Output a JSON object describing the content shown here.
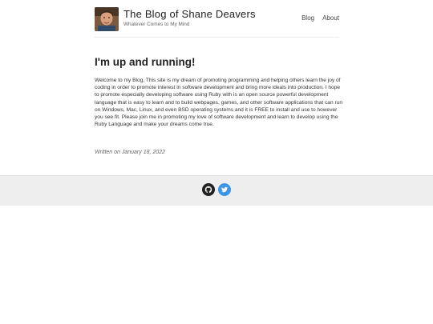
{
  "site": {
    "title": "The Blog of Shane Deavers",
    "tagline": "Whatever Comes to My Mind"
  },
  "nav": {
    "items": [
      {
        "label": "Blog"
      },
      {
        "label": "About"
      }
    ]
  },
  "post": {
    "title": "I'm up and running!",
    "body": "Welcome to my Blog, This site is my dream of promoting programming and helping others learn the joy of coding in order to promote interest in software development and bring more ideals into production. I hope to promote especially developing software using Ruby with is an open source powerful development language that is easy to learn and to build webpages, games, and other software applications that can run on Windows, Mac, Linux, and even BSD operating systems and it is FREE to install and use to however you see fit. Please join me in promoting my love of software development and learn to develop using the Ruby Language and make your dreams come true.",
    "date": "Written on January 18, 2022"
  },
  "footer": {
    "icons": [
      {
        "name": "github-icon",
        "color": "#222222"
      },
      {
        "name": "twitter-icon",
        "color": "#3d95e6"
      }
    ]
  }
}
